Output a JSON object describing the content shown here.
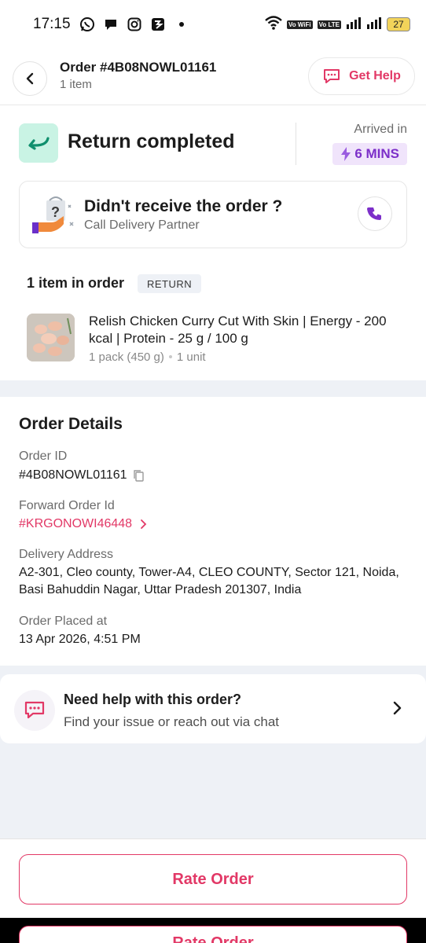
{
  "status_bar": {
    "time": "17:15",
    "battery": "27",
    "vowifi_tag": "Vo WiFi",
    "volte_tag": "Vo LTE"
  },
  "header": {
    "title": "Order #4B08NOWL01161",
    "subtitle": "1 item",
    "help_label": "Get Help"
  },
  "status": {
    "title": "Return completed",
    "arrived_label": "Arrived in",
    "arrived_value": "6 MINS"
  },
  "delivery_issue": {
    "title": "Didn't receive the order ?",
    "subtitle": "Call Delivery Partner"
  },
  "items": {
    "count_label": "1 item in order",
    "badge": "RETURN",
    "list": [
      {
        "name": "Relish Chicken Curry Cut With Skin | Energy - 200 kcal | Protein - 25 g / 100 g",
        "pack": "1 pack (450 g)",
        "qty": "1 unit"
      }
    ]
  },
  "order_details": {
    "title": "Order Details",
    "order_id_label": "Order ID",
    "order_id": "#4B08NOWL01161",
    "forward_label": "Forward Order Id",
    "forward_id": "#KRGONOWI46448",
    "address_label": "Delivery Address",
    "address": "A2-301, Cleo county, Tower-A4, CLEO COUNTY, Sector 121, Noida, Basi Bahuddin Nagar, Uttar Pradesh 201307, India",
    "placed_label": "Order Placed at",
    "placed_at": "13 Apr 2026, 4:51 PM"
  },
  "help_card": {
    "title": "Need help with this order?",
    "subtitle": "Find your issue or reach out via chat"
  },
  "footer": {
    "rate_label": "Rate Order"
  },
  "colors": {
    "accent": "#e23866",
    "purple": "#7c2fc9",
    "return_green": "#c9f3e4",
    "bg": "#eef1f6"
  }
}
